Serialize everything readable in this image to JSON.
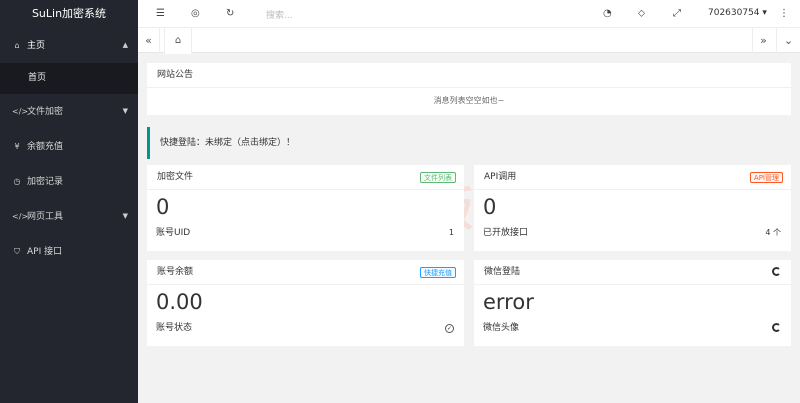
{
  "app": {
    "title": "SuLin加密系统"
  },
  "sidebar": {
    "items": [
      {
        "label": "主页",
        "icon": "home-icon",
        "glyph": "⌂",
        "arrow": "▲"
      },
      {
        "label": "文件加密",
        "icon": "code-icon",
        "glyph": "</>",
        "arrow": "▼"
      },
      {
        "label": "余额充值",
        "icon": "yen-icon",
        "glyph": "¥"
      },
      {
        "label": "加密记录",
        "icon": "clock-icon",
        "glyph": "◷"
      },
      {
        "label": "网页工具",
        "icon": "code-icon",
        "glyph": "</>",
        "arrow": "▼"
      },
      {
        "label": "API 接口",
        "icon": "shield-icon",
        "glyph": "⛉"
      }
    ],
    "sub_items": [
      {
        "label": "首页"
      }
    ]
  },
  "topbar": {
    "search_placeholder": "搜索...",
    "username": "702630754 ▾",
    "icons": [
      "menu-icon",
      "globe-icon",
      "refresh-icon",
      "dashboard-icon",
      "tag-icon",
      "fullscreen-icon",
      "more-icon"
    ]
  },
  "tabs": {
    "left": "«",
    "home": "⌂",
    "right": "»",
    "dropdown": "⌄"
  },
  "notice": {
    "title": "网站公告",
    "body": "消息列表空空如也~"
  },
  "quick_login": {
    "text": "快捷登陆：未绑定（点击绑定）！"
  },
  "cards": {
    "encrypt_files": {
      "title": "加密文件",
      "badge": "文件列表",
      "value": "0",
      "foot_label": "账号UID",
      "foot_value": "1"
    },
    "api_calls": {
      "title": "API调用",
      "badge": "API管理",
      "value": "0",
      "foot_label": "已开放接口",
      "foot_value": "4 个"
    },
    "balance": {
      "title": "账号余额",
      "badge": "快捷充值",
      "value": "0.00",
      "foot_label": "账号状态",
      "foot_value": "✓"
    },
    "wechat": {
      "title": "微信登陆",
      "value": "error",
      "foot_label": "微信头像"
    }
  },
  "watermark": {
    "text": "一淘模版"
  },
  "colors": {
    "sidebar_bg": "#23262e",
    "accent": "#009688",
    "green": "#5fb878",
    "red": "#ff5722",
    "blue": "#1e9fff"
  }
}
